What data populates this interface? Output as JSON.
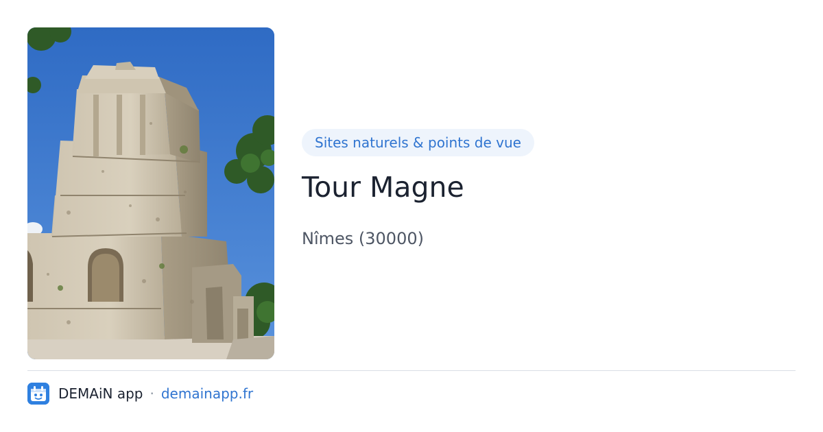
{
  "card": {
    "image_subject": "tower-photo",
    "category": "Sites naturels & points de vue",
    "title": "Tour Magne",
    "location": "Nîmes (30000)"
  },
  "footer": {
    "app_name": "DEMAiN app",
    "separator": "·",
    "domain": "demainapp.fr"
  },
  "colors": {
    "accent": "#2f74d0",
    "pill_background": "#eef4fc",
    "title": "#1b2230",
    "subtitle": "#4e5664",
    "divider": "#d9dee5",
    "sky": "#3a73c6"
  }
}
